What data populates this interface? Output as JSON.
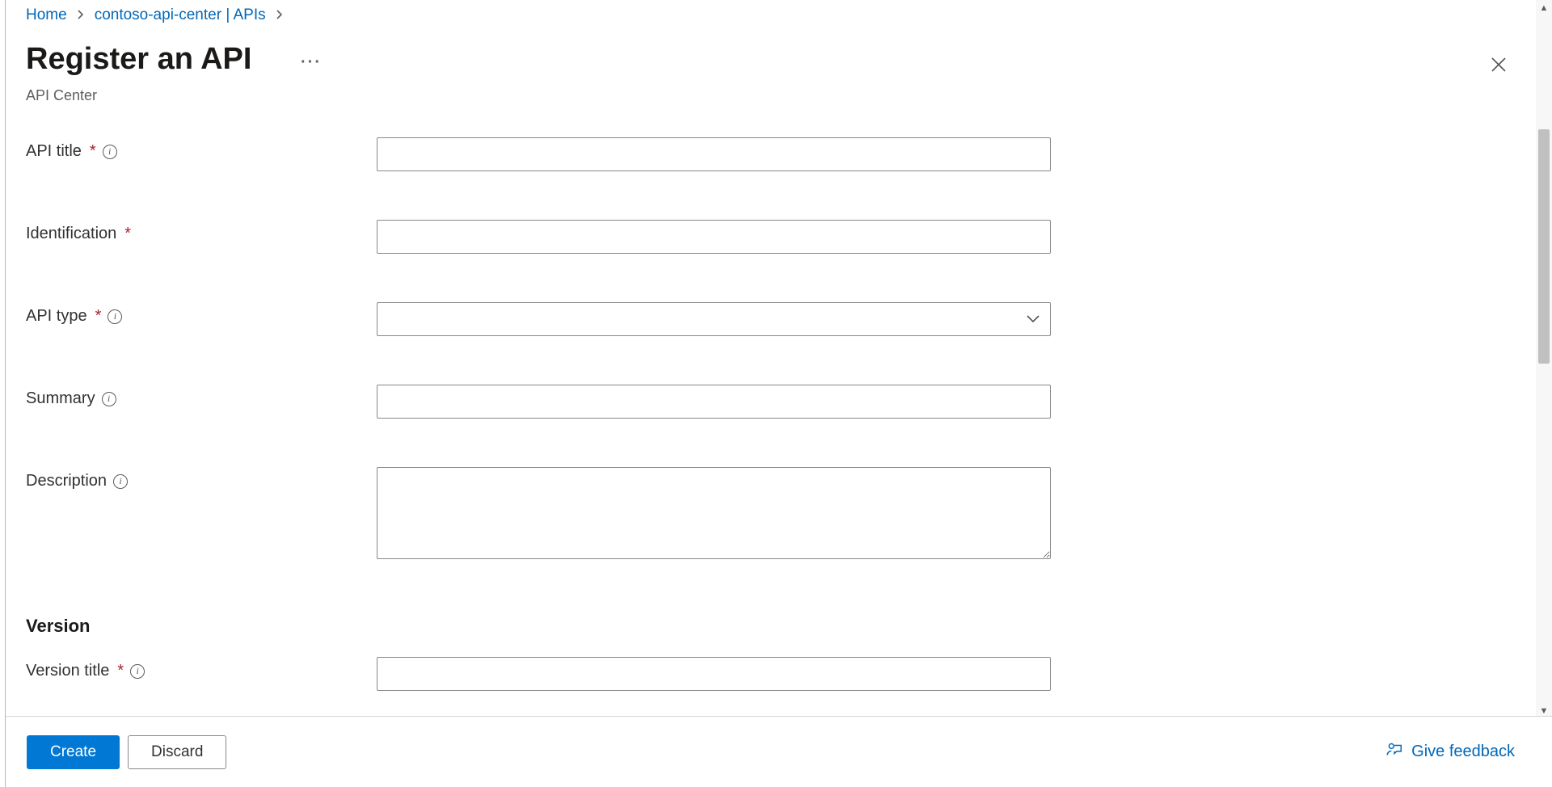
{
  "breadcrumb": {
    "home": "Home",
    "center": "contoso-api-center | APIs"
  },
  "header": {
    "title": "Register an API",
    "subtitle": "API Center"
  },
  "form": {
    "api_title": {
      "label": "API title",
      "value": ""
    },
    "identification": {
      "label": "Identification",
      "value": ""
    },
    "api_type": {
      "label": "API type",
      "value": ""
    },
    "summary": {
      "label": "Summary",
      "value": ""
    },
    "description": {
      "label": "Description",
      "value": ""
    }
  },
  "version": {
    "heading": "Version",
    "title": {
      "label": "Version title",
      "value": ""
    }
  },
  "footer": {
    "create": "Create",
    "discard": "Discard",
    "feedback": "Give feedback"
  }
}
